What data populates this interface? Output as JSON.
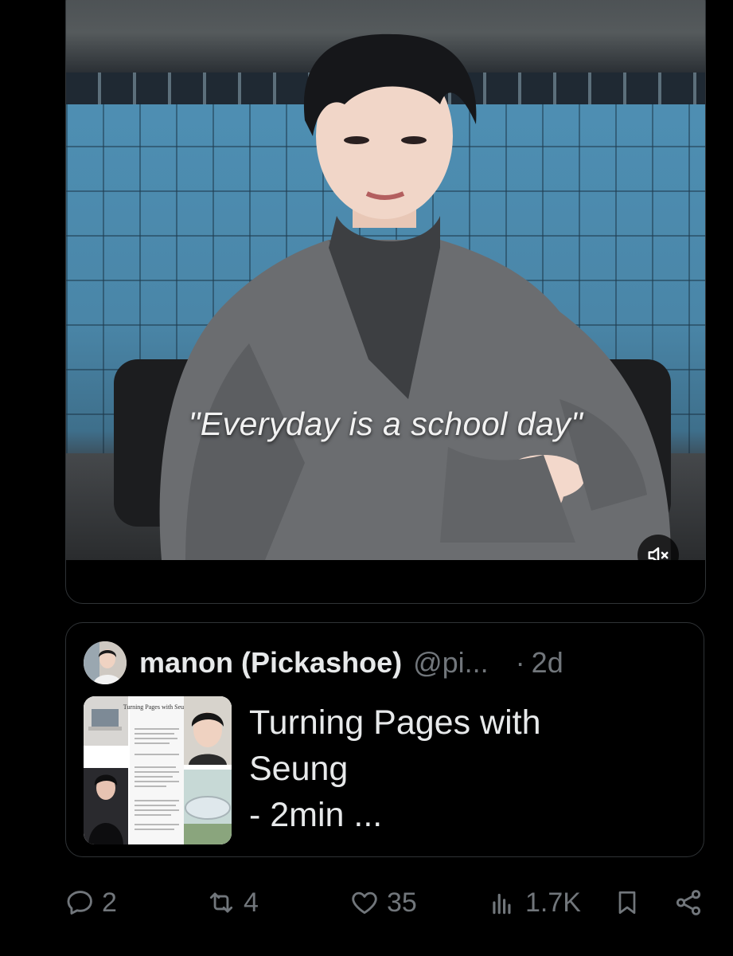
{
  "video": {
    "caption": "\"Everyday is a school day\"",
    "mute_icon": "volume-muted-icon"
  },
  "quote": {
    "display_name": "manon (Pickashoe)",
    "handle": "@pi...",
    "separator": "·",
    "time": "2d",
    "title_lines": [
      "Turning Pages with",
      "Seung",
      "- 2min ..."
    ],
    "thumbnail_text": "Turning Pages with Seung"
  },
  "actions": {
    "replies": "2",
    "reposts": "4",
    "likes": "35",
    "views": "1.7K"
  },
  "colors": {
    "background": "#000000",
    "text": "#e7e9ea",
    "muted": "#71767b",
    "border": "#2f3336"
  }
}
